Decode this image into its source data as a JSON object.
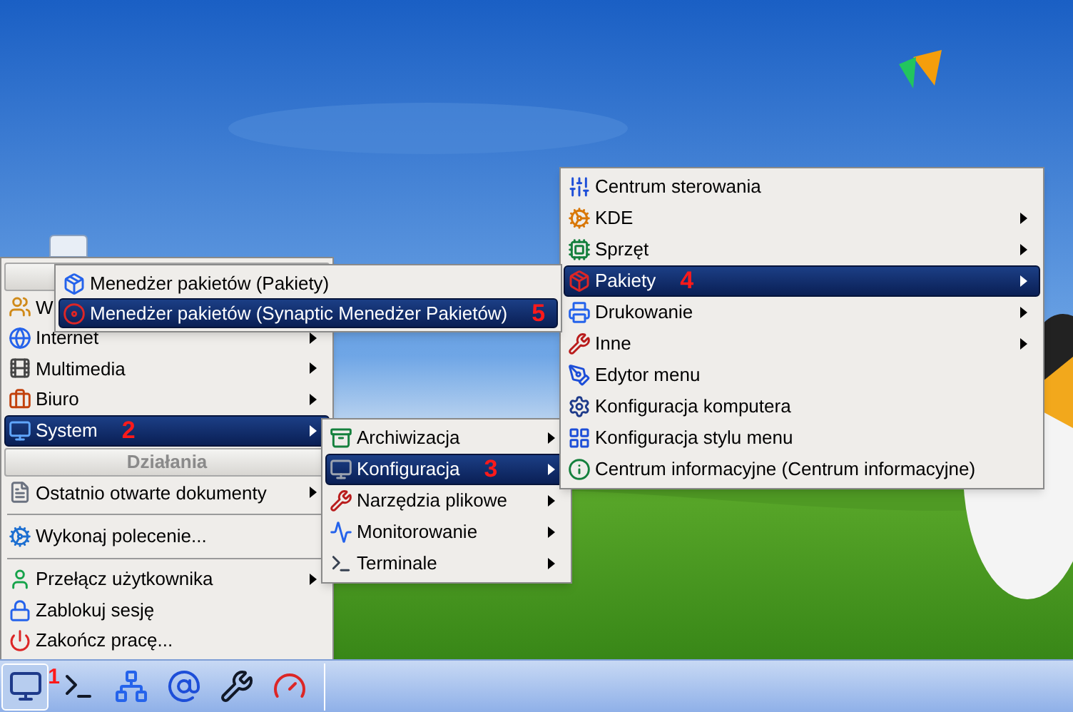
{
  "main_menu": {
    "items": [
      {
        "kind": "header"
      },
      {
        "kind": "item",
        "label": "W",
        "selected": false
      },
      {
        "kind": "item",
        "label": "Internet",
        "submenu": true,
        "selected": false
      },
      {
        "kind": "item",
        "label": "Multimedia",
        "submenu": true,
        "selected": false
      },
      {
        "kind": "item",
        "label": "Biuro",
        "submenu": true,
        "selected": false
      },
      {
        "kind": "item",
        "label": "System",
        "submenu": true,
        "selected": true,
        "badge": "2"
      },
      {
        "kind": "header",
        "label": "Działania"
      },
      {
        "kind": "item",
        "label": "Ostatnio otwarte dokumenty",
        "submenu": true,
        "selected": false
      },
      {
        "kind": "separator"
      },
      {
        "kind": "item",
        "label": "Wykonaj polecenie...",
        "submenu": false,
        "selected": false
      },
      {
        "kind": "separator"
      },
      {
        "kind": "item",
        "label": "Przełącz użytkownika",
        "submenu": true,
        "selected": false
      },
      {
        "kind": "item",
        "label": "Zablokuj sesję",
        "submenu": false,
        "selected": false
      },
      {
        "kind": "item",
        "label": "Zakończ pracę...",
        "submenu": false,
        "selected": false
      }
    ]
  },
  "system_menu": {
    "items": [
      {
        "kind": "item",
        "label": "Archiwizacja",
        "submenu": true,
        "selected": false
      },
      {
        "kind": "item",
        "label": "Konfiguracja",
        "submenu": true,
        "selected": true,
        "badge": "3"
      },
      {
        "kind": "item",
        "label": "Narzędzia plikowe",
        "submenu": true,
        "selected": false
      },
      {
        "kind": "item",
        "label": "Monitorowanie",
        "submenu": true,
        "selected": false
      },
      {
        "kind": "item",
        "label": "Terminale",
        "submenu": true,
        "selected": false
      }
    ]
  },
  "config_menu": {
    "items": [
      {
        "kind": "item",
        "label": "Centrum sterowania",
        "submenu": false,
        "selected": false
      },
      {
        "kind": "item",
        "label": "KDE",
        "submenu": true,
        "selected": false
      },
      {
        "kind": "item",
        "label": "Sprzęt",
        "submenu": true,
        "selected": false
      },
      {
        "kind": "item",
        "label": "Pakiety",
        "submenu": true,
        "selected": true,
        "badge": "4"
      },
      {
        "kind": "item",
        "label": "Drukowanie",
        "submenu": true,
        "selected": false
      },
      {
        "kind": "item",
        "label": "Inne",
        "submenu": true,
        "selected": false
      },
      {
        "kind": "item",
        "label": "Edytor menu",
        "submenu": false,
        "selected": false
      },
      {
        "kind": "item",
        "label": "Konfiguracja komputera",
        "submenu": false,
        "selected": false
      },
      {
        "kind": "item",
        "label": "Konfiguracja stylu menu",
        "submenu": false,
        "selected": false
      },
      {
        "kind": "item",
        "label": "Centrum informacyjne (Centrum informacyjne)",
        "submenu": false,
        "selected": false
      }
    ]
  },
  "packages_menu": {
    "items": [
      {
        "kind": "item",
        "label": "Menedżer pakietów (Pakiety)",
        "submenu": false,
        "selected": false
      },
      {
        "kind": "item",
        "label": "Menedżer pakietów (Synaptic Menedżer Pakietów)",
        "submenu": false,
        "selected": true,
        "badge": "5"
      }
    ]
  },
  "taskbar": {
    "launchers": [
      {
        "selected": true,
        "badge": "1"
      },
      {
        "selected": false
      },
      {
        "selected": false
      },
      {
        "selected": false
      },
      {
        "selected": false
      },
      {
        "selected": false
      }
    ]
  }
}
